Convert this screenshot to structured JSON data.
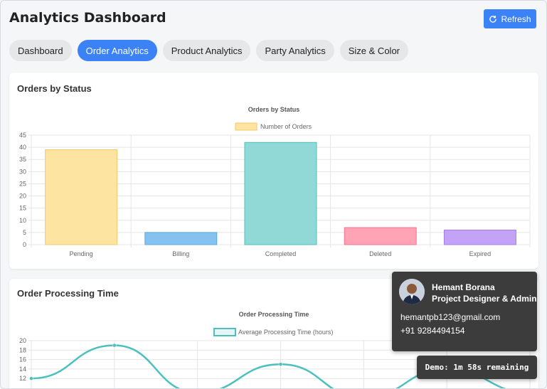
{
  "header": {
    "title": "Analytics Dashboard",
    "refresh_label": "Refresh"
  },
  "tabs": [
    {
      "label": "Dashboard",
      "active": false
    },
    {
      "label": "Order Analytics",
      "active": true
    },
    {
      "label": "Product Analytics",
      "active": false
    },
    {
      "label": "Party Analytics",
      "active": false
    },
    {
      "label": "Size & Color",
      "active": false
    }
  ],
  "cards": {
    "status_title": "Orders by Status",
    "processing_title": "Order Processing Time"
  },
  "colors": {
    "accent": "#3b82f6",
    "tooltip_bg": "#3c3c3c"
  },
  "chart_data": [
    {
      "type": "bar",
      "title": "Orders by Status",
      "categories": [
        "Pending",
        "Billing",
        "Completed",
        "Deleted",
        "Expired"
      ],
      "series": [
        {
          "name": "Number of Orders",
          "values": [
            39,
            5,
            42,
            7,
            6
          ]
        }
      ],
      "bar_fills": [
        "#fde4a0",
        "#85c2f0",
        "#90d9d7",
        "#ffa3b5",
        "#c3a3f5"
      ],
      "bar_strokes": [
        "#f5c96a",
        "#5aa7e0",
        "#4dc0bd",
        "#ff6f8f",
        "#a27cf0"
      ],
      "ylim": [
        0,
        45
      ],
      "yticks": [
        0,
        5,
        10,
        15,
        20,
        25,
        30,
        35,
        40,
        45
      ],
      "grid": true,
      "legend": "top"
    },
    {
      "type": "line",
      "title": "Order Processing Time",
      "x_count": 7,
      "series": [
        {
          "name": "Average Processing Time (hours)",
          "values": [
            12,
            19,
            9,
            15,
            8,
            14,
            9
          ]
        }
      ],
      "ylim": [
        0,
        20
      ],
      "yticks": [
        12,
        14,
        16,
        18,
        20
      ],
      "grid": true,
      "legend": "top",
      "line_color": "#4bc0c0"
    }
  ],
  "profile": {
    "name": "Hemant Borana",
    "role": "Project Designer & Admin",
    "email": "hemantpb123@gmail.com",
    "phone": "+91 9284494154"
  },
  "demo": {
    "text": "Demo: 1m 58s remaining"
  }
}
